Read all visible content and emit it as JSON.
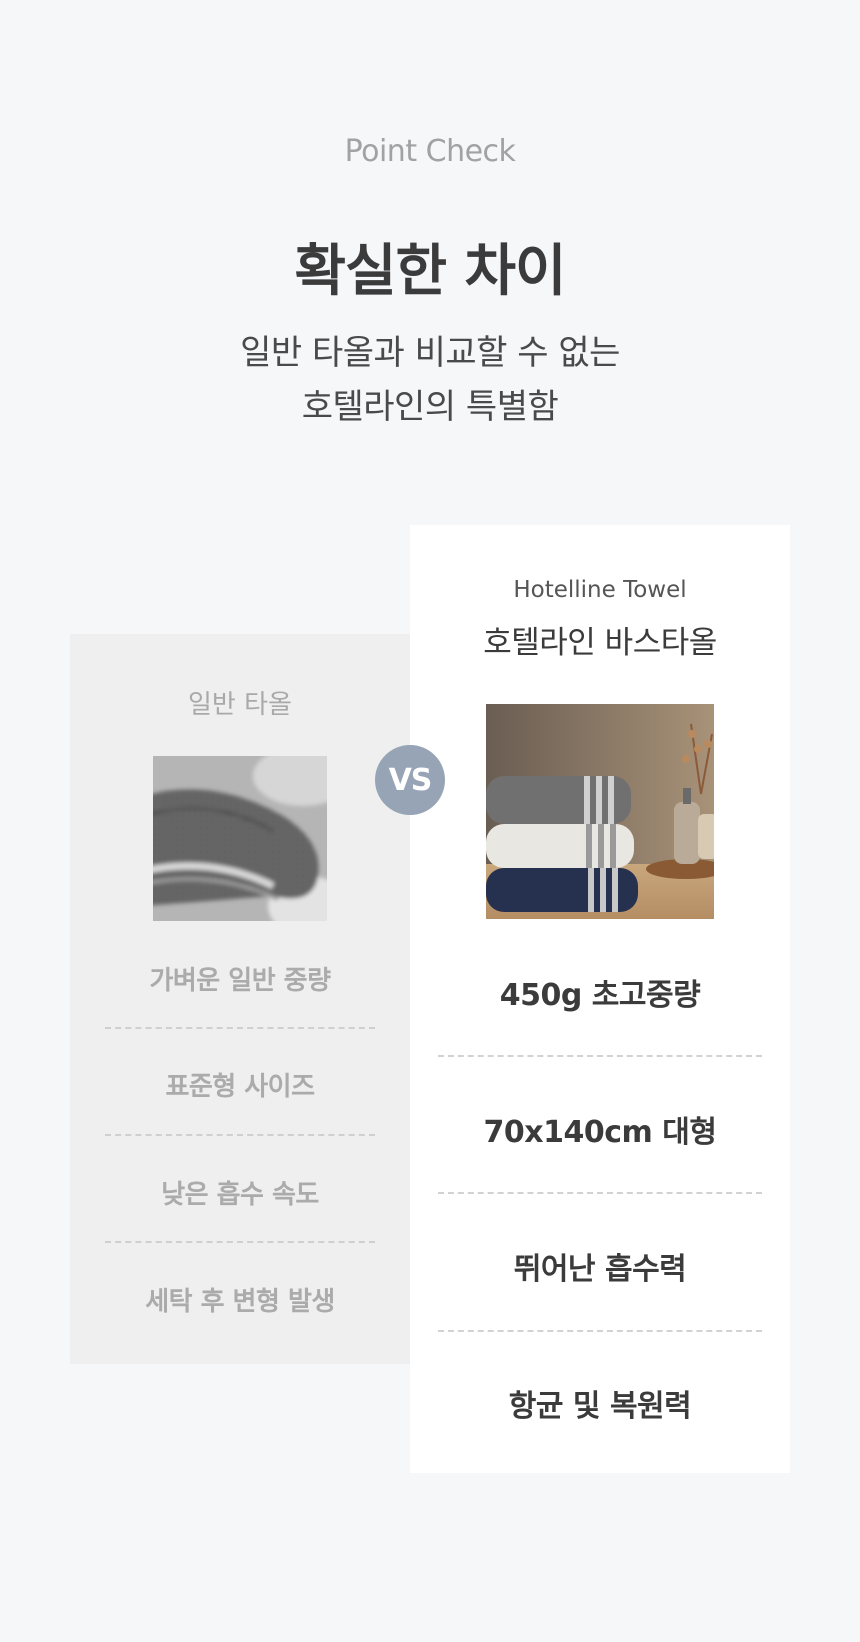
{
  "header": {
    "eyebrow": "Point Check",
    "title": "확실한 차이",
    "subtitle_line1": "일반 타올과 비교할 수 없는",
    "subtitle_line2": "호텔라인의 특별함"
  },
  "left_card": {
    "heading": "일반 타올",
    "photo_icon": "gray-towel-closeup-photo",
    "features": [
      "가벼운 일반 중량",
      "표준형 사이즈",
      "낮은 흡수 속도",
      "세탁 후 변형 발생"
    ]
  },
  "vs_badge": {
    "label": "VS"
  },
  "right_card": {
    "eyebrow": "Hotelline Towel",
    "heading": "호텔라인 바스타올",
    "photo_icon": "stacked-towels-photo",
    "features": [
      "450g 초고중량",
      "70x140cm 대형",
      "뛰어난 흡수력",
      "항균 및 복원력"
    ]
  },
  "colors": {
    "page_background": "#f6f7f9",
    "left_card_background": "#efefef",
    "right_card_background": "#ffffff",
    "vs_badge": "#97a4b5",
    "muted_text": "#a9a9a9",
    "strong_text": "#3b3b3b"
  }
}
